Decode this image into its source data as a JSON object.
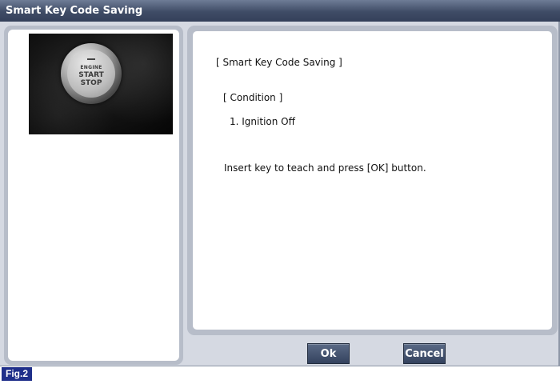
{
  "window": {
    "title": "Smart Key Code Saving"
  },
  "photo": {
    "button_text_top": "ENGINE",
    "button_text_middle": "START",
    "button_text_bottom": "STOP"
  },
  "message": {
    "title": "[ Smart Key Code Saving ]",
    "condition_header": "[ Condition ]",
    "condition_items": [
      "1. Ignition Off"
    ],
    "instruction": "Insert key to teach and press [OK] button."
  },
  "buttons": {
    "ok_label": "Ok",
    "cancel_label": "Cancel"
  },
  "figure_label": "Fig.2"
}
